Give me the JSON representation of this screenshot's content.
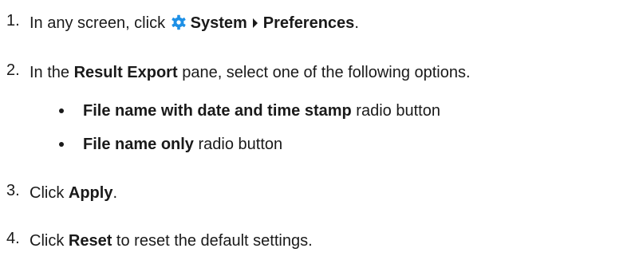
{
  "steps": [
    {
      "number": "1.",
      "pre": "In any screen, click ",
      "gear_icon": "gear-icon",
      "menu": "System",
      "caret_icon": "caret-right-icon",
      "item": "Preferences",
      "post": "."
    },
    {
      "number": "2.",
      "pre": "In the ",
      "pane": "Result Export",
      "post": " pane, select one of the following options."
    },
    {
      "number": "3.",
      "pre": "Click ",
      "button": "Apply",
      "post": "."
    },
    {
      "number": "4.",
      "pre": "Click ",
      "button": "Reset",
      "post": " to reset the default settings."
    }
  ],
  "options": [
    {
      "name": "File name with date and time stamp",
      "suffix": " radio button"
    },
    {
      "name": "File name only",
      "suffix": " radio button"
    }
  ],
  "colors": {
    "text": "#1a1a1a",
    "gear_icon": "#1e90e6"
  }
}
